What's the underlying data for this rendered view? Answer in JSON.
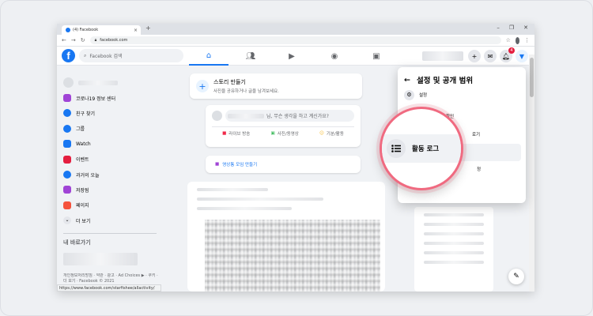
{
  "browser": {
    "tab_title": "(4) Facebook",
    "url": "facebook.com",
    "status_url": "https://www.facebook.com/starfishee/allactivity/"
  },
  "header": {
    "search_placeholder": "Facebook 검색",
    "notification_count": "4"
  },
  "sidebar": {
    "items": [
      {
        "label": "코로나19 정보 센터",
        "icon": "shield-icon",
        "color": "#a044d6"
      },
      {
        "label": "친구 찾기",
        "icon": "friends-icon",
        "color": "#1877f2"
      },
      {
        "label": "그룹",
        "icon": "groups-icon",
        "color": "#1877f2"
      },
      {
        "label": "Watch",
        "icon": "watch-icon",
        "color": "#1877f2"
      },
      {
        "label": "이벤트",
        "icon": "calendar-icon",
        "color": "#e41e3f"
      },
      {
        "label": "과거의 오늘",
        "icon": "clock-icon",
        "color": "#1877f2"
      },
      {
        "label": "저장됨",
        "icon": "bookmark-icon",
        "color": "#a044d6"
      },
      {
        "label": "페이지",
        "icon": "flag-icon",
        "color": "#f5533d"
      },
      {
        "label": "더 보기",
        "icon": "chevron-down-icon",
        "color": "#65676b"
      }
    ],
    "shortcuts_heading": "내 바로가기",
    "footer": "개인정보처리방침 · 약관 · 광고 · Ad Choices ▶ · 쿠키 · 더 보기 · Facebook © 2021"
  },
  "story": {
    "title": "스토리 만들기",
    "subtitle": "사진을 공유하거나 글을 남겨보세요."
  },
  "composer": {
    "prompt": "님, 무슨 생각을 하고 계신가요?",
    "actions": [
      {
        "label": "라이브 방송",
        "color": "#f02849"
      },
      {
        "label": "사진/동영상",
        "color": "#45bd62"
      },
      {
        "label": "기분/활동",
        "color": "#f7b928"
      }
    ],
    "room_label": "영상통 모임 만들기"
  },
  "menu": {
    "title": "설정 및 공개 범위",
    "settings_label": "설정",
    "peek_1": "확인",
    "peek_2": "로기",
    "peek_3": "정",
    "activity_log": "활동 로그"
  }
}
